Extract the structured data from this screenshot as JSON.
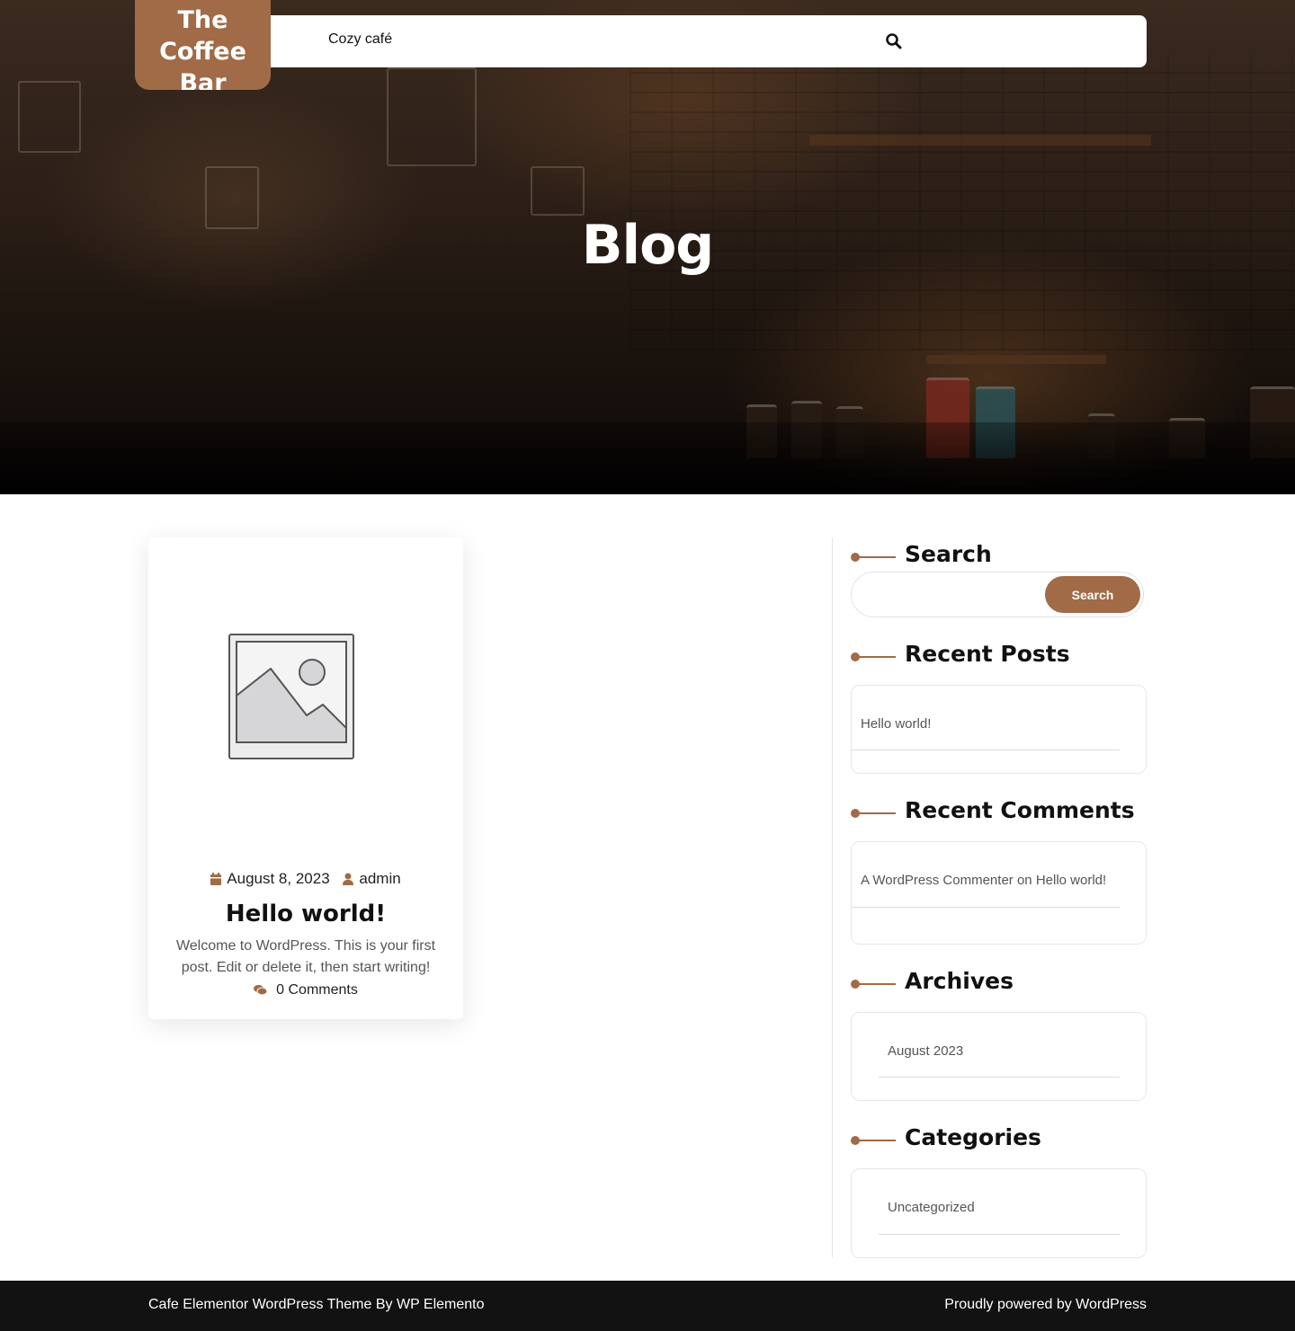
{
  "header": {
    "logo_text": "The Coffee Bar",
    "nav_items": [
      "Cozy café"
    ]
  },
  "hero": {
    "title": "Blog"
  },
  "post": {
    "date": "August 8, 2023",
    "author": "admin",
    "title": "Hello world!",
    "excerpt": "Welcome to WordPress. This is your first post. Edit or delete it, then start writing!",
    "comments": "0 Comments"
  },
  "sidebar": {
    "search": {
      "title": "Search",
      "button_label": "Search",
      "placeholder": ""
    },
    "recent_posts": {
      "title": "Recent Posts",
      "items": [
        "Hello world!"
      ]
    },
    "recent_comments": {
      "title": "Recent Comments",
      "author": "A WordPress Commenter",
      "connector": "on",
      "post": "Hello world!"
    },
    "archives": {
      "title": "Archives",
      "items": [
        "August 2023"
      ]
    },
    "categories": {
      "title": "Categories",
      "items": [
        "Uncategorized"
      ]
    }
  },
  "footer": {
    "credit": "Cafe Elementor WordPress Theme By WP Elemento",
    "powered": "Proudly powered by WordPress"
  },
  "colors": {
    "accent": "#a06b46",
    "footer_bg": "#121212",
    "text_dark": "#111111",
    "text_muted": "#555555"
  },
  "icons": [
    "search-icon",
    "calendar-icon",
    "user-icon",
    "comments-icon",
    "image-placeholder-icon"
  ]
}
